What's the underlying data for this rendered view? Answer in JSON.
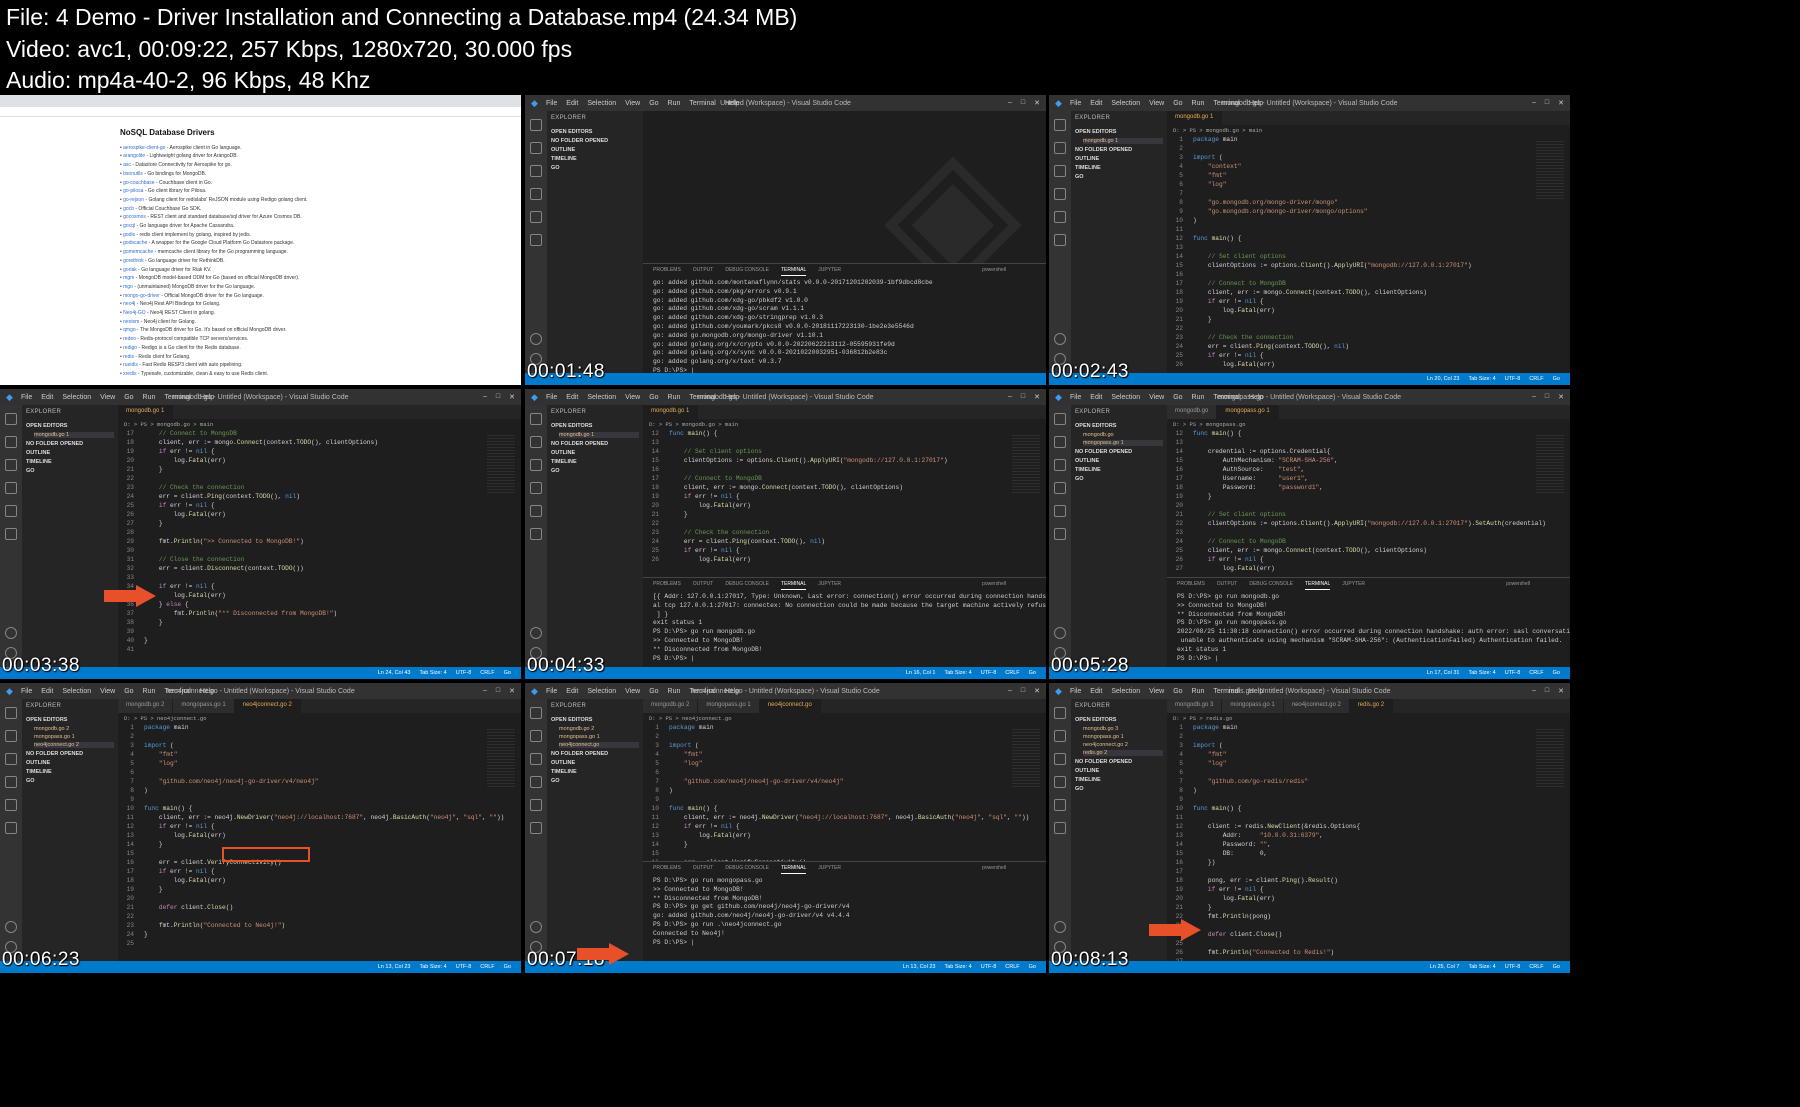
{
  "header": {
    "file_line": "File: 4  Demo - Driver Installation and Connecting a Database.mp4 (24.34 MB)",
    "video_line": "Video: avc1, 00:09:22, 257 Kbps, 1280x720, 30.000 fps",
    "audio_line": "Audio: mp4a-40-2, 96 Kbps, 48 Khz"
  },
  "vscode": {
    "menu": [
      "File",
      "Edit",
      "Selection",
      "View",
      "Go",
      "Run",
      "Terminal",
      "Help"
    ],
    "explorer": "EXPLORER",
    "open_editors": "OPEN EDITORS",
    "no_folder": "NO FOLDER OPENED",
    "outline": "OUTLINE",
    "timeline": "TIMELINE",
    "go": "GO",
    "panel_tabs": [
      "PROBLEMS",
      "OUTPUT",
      "DEBUG CONSOLE",
      "TERMINAL",
      "JUPYTER"
    ],
    "terminal_label": "powershell"
  },
  "thumbs": [
    {
      "timestamp": "",
      "browser": {
        "heading": "NoSQL Database Drivers",
        "items": [
          "aerospike-client-go - Aerospike client in Go language.",
          "arangolite - Lightweight golang driver for ArangoDB.",
          "asc - Datastore Connectivity for Aerospike for go.",
          "bsonutils - Go bindings for MongoDB.",
          "go-couchbase - Couchbase client in Go.",
          "go-pilosa - Go client library for Pilosa.",
          "go-rejson - Golang client for redislabs' ReJSON module using Redigo golang client.",
          "gocb - Official Couchbase Go SDK.",
          "gocosmos - REST client and standard database/sql driver for Azure Cosmos DB.",
          "gocql - Go language driver for Apache Cassandra.",
          "godis - redis client implement by golang, inspired by jedis.",
          "godscache - A wrapper for the Google Cloud Platform Go Datastore package.",
          "gomemcache - memcache client library for the Go programming language.",
          "gorethink - Go language driver for RethinkDB.",
          "goriak - Go language driver for Riak KV.",
          "mgm - MongoDB model-based ODM for Go (based on official MongoDB driver).",
          "mgo - (unmaintained) MongoDB driver for the Go language.",
          "mongo-go-driver - Official MongoDB driver for the Go language.",
          "neo4j - Neo4j Rest API Bindings for Golang.",
          "Neo4j-GO - Neo4j REST Client in golang.",
          "neoism - Neo4j client for Golang.",
          "qmgo - The MongoDB driver for Go. It's based on official MongoDB driver.",
          "redeo - Redis-protocol compatible TCP servers/services.",
          "redigo - Redigo is a Go client for the Redis database.",
          "redis - Redis client for Golang.",
          "rueidis - Fast Redis RESP3 client with auto pipelining.",
          "xredis - Typesafe, customizable, clean & easy to use Redis client."
        ],
        "heading2": "Search and Analytic Databases"
      }
    },
    {
      "timestamp": "00:01:48",
      "title": "Untitled (Workspace) - Visual Studio Code",
      "terminal": [
        "go: added github.com/montanaflynn/stats v0.0.0-20171201202039-1bf9dbcd8cbe",
        "go: added github.com/pkg/errors v0.9.1",
        "go: added github.com/xdg-go/pbkdf2 v1.0.0",
        "go: added github.com/xdg-go/scram v1.1.1",
        "go: added github.com/xdg-go/stringprep v1.0.3",
        "go: added github.com/youmark/pkcs8 v0.0.0-20181117223130-1be2e3e5546d",
        "go: added go.mongodb.org/mongo-driver v1.10.1",
        "go: added golang.org/x/crypto v0.0.0-20220622213112-05595931fe9d",
        "go: added golang.org/x/sync v0.0.0-20210220032951-036812b2e83c",
        "go: added golang.org/x/text v0.3.7",
        "PS D:\\PS> |"
      ]
    },
    {
      "timestamp": "00:02:43",
      "title": "mongodb.go - Untitled (Workspace) - Visual Studio Code",
      "tabs": [
        "mongodb.go 1"
      ],
      "crumb": "D: > PS > mongodb.go > main",
      "code_start": 1,
      "code": [
        "package main",
        "",
        "import (",
        "    \"context\"",
        "    \"fmt\"",
        "    \"log\"",
        "",
        "    \"go.mongodb.org/mongo-driver/mongo\"",
        "    \"go.mongodb.org/mongo-driver/mongo/options\"",
        ")",
        "",
        "func main() {",
        "",
        "    // Set client options",
        "    clientOptions := options.Client().ApplyURI(\"mongodb://127.0.0.1:27017\")",
        "",
        "    // Connect to MongoDB",
        "    client, err := mongo.Connect(context.TODO(), clientOptions)",
        "    if err != nil {",
        "        log.Fatal(err)",
        "    }",
        "",
        "    // Check the connection",
        "    err = client.Ping(context.TODO(), nil)",
        "    if err != nil {",
        "        log.Fatal(err)"
      ],
      "status": [
        "Ln 20, Col 23",
        "Tab Size: 4",
        "UTF-8",
        "CRLF",
        "Go"
      ]
    },
    {
      "timestamp": "00:03:38",
      "title": "mongodb.go - Untitled (Workspace) - Visual Studio Code",
      "tabs": [
        "mongodb.go 1"
      ],
      "crumb": "D: > PS > mongodb.go > main",
      "code_start": 17,
      "code": [
        "    // Connect to MongoDB",
        "    client, err := mongo.Connect(context.TODO(), clientOptions)",
        "    if err != nil {",
        "        log.Fatal(err)",
        "    }",
        "",
        "    // Check the connection",
        "    err = client.Ping(context.TODO(), nil)",
        "    if err != nil {",
        "        log.Fatal(err)",
        "    }",
        "",
        "    fmt.Println(\">> Connected to MongoDB!\")",
        "",
        "    // Close the connection",
        "    err = client.Disconnect(context.TODO())",
        "",
        "    if err != nil {",
        "        log.Fatal(err)",
        "    } else {",
        "        fmt.Println(\"** Disconnected from MongoDB!\")",
        "    }",
        "",
        "}",
        ""
      ],
      "status": [
        "Ln 24, Col 43",
        "Tab Size: 4",
        "UTF-8",
        "CRLF",
        "Go"
      ]
    },
    {
      "timestamp": "00:04:33",
      "title": "mongodb.go - Untitled (Workspace) - Visual Studio Code",
      "tabs": [
        "mongodb.go 1"
      ],
      "crumb": "D: > PS > mongodb.go > main",
      "code_start": 12,
      "code": [
        "func main() {",
        "",
        "    // Set client options",
        "    clientOptions := options.Client().ApplyURI(\"mongodb://127.0.0.1:27017\")",
        "",
        "    // Connect to MongoDB",
        "    client, err := mongo.Connect(context.TODO(), clientOptions)",
        "    if err != nil {",
        "        log.Fatal(err)",
        "    }",
        "",
        "    // Check the connection",
        "    err = client.Ping(context.TODO(), nil)",
        "    if err != nil {",
        "        log.Fatal(err)"
      ],
      "terminal": [
        "[{ Addr: 127.0.0.1:27017, Type: Unknown, Last error: connection() error occurred during connection handshake: di",
        "al tcp 127.0.0.1:27017: connectex: No connection could be made because the target machine actively refused it. },",
        " ] }",
        "exit status 1",
        "PS D:\\PS> go run mongodb.go",
        ">> Connected to MongoDB!",
        "** Disconnected from MongoDB!",
        "PS D:\\PS> |"
      ],
      "status": [
        "Ln 16, Col 1",
        "Tab Size: 4",
        "UTF-8",
        "CRLF",
        "Go"
      ]
    },
    {
      "timestamp": "00:05:28",
      "title": "mongopass.go - Untitled (Workspace) - Visual Studio Code",
      "tabs": [
        "mongodb.go",
        "mongopass.go 1"
      ],
      "crumb": "D: > PS > mongopass.go",
      "code_start": 12,
      "code": [
        "func main() {",
        "",
        "    credential := options.Credential{",
        "        AuthMechanism: \"SCRAM-SHA-256\",",
        "        AuthSource:    \"test\",",
        "        Username:      \"user1\",",
        "        Password:      \"password1\",",
        "    }",
        "",
        "    // Set client options",
        "    clientOptions := options.Client().ApplyURI(\"mongodb://127.0.0.1:27017\").SetAuth(credential)",
        "",
        "    // Connect to MongoDB",
        "    client, err := mongo.Connect(context.TODO(), clientOptions)",
        "    if err != nil {",
        "        log.Fatal(err)"
      ],
      "terminal": [
        "PS D:\\PS> go run mongodb.go",
        ">> Connected to MongoDB!",
        "** Disconnected from MongoDB!",
        "PS D:\\PS> go run mongopass.go",
        "2022/08/25 11:30:18 connection() error occurred during connection handshake: auth error: sasl conversation error:",
        " unable to authenticate using mechanism \"SCRAM-SHA-256\": (AuthenticationFailed) Authentication failed.",
        "exit status 1",
        "PS D:\\PS> |"
      ],
      "status": [
        "Ln 17, Col 31",
        "Tab Size: 4",
        "UTF-8",
        "CRLF",
        "Go"
      ]
    },
    {
      "timestamp": "00:06:23",
      "title": "neo4jconnect.go - Untitled (Workspace) - Visual Studio Code",
      "tabs": [
        "mongodb.go 2",
        "mongopass.go 1",
        "neo4jconnect.go 2"
      ],
      "crumb": "D: > PS > neo4jconnect.go",
      "code_start": 1,
      "code": [
        "package main",
        "",
        "import (",
        "    \"fmt\"",
        "    \"log\"",
        "",
        "    \"github.com/neo4j/neo4j-go-driver/v4/neo4j\"",
        ")",
        "",
        "func main() {",
        "    client, err := neo4j.NewDriver(\"neo4j://localhost:7687\", neo4j.BasicAuth(\"neo4j\", \"sql\", \"\"))",
        "    if err != nil {",
        "        log.Fatal(err)",
        "    }",
        "",
        "    err = client.VerifyConnectivity()",
        "    if err != nil {",
        "        log.Fatal(err)",
        "    }",
        "",
        "    defer client.Close()",
        "",
        "    fmt.Println(\"Connected to Neo4j!\")",
        "}",
        ""
      ],
      "status": [
        "Ln 13, Col 23",
        "Tab Size: 4",
        "UTF-8",
        "CRLF",
        "Go"
      ]
    },
    {
      "timestamp": "00:07:18",
      "title": "neo4jconnect.go - Untitled (Workspace) - Visual Studio Code",
      "tabs": [
        "mongodb.go 2",
        "mongopass.go 1",
        "neo4jconnect.go"
      ],
      "crumb": "D: > PS > neo4jconnect.go",
      "code_start": 1,
      "code": [
        "package main",
        "",
        "import (",
        "    \"fmt\"",
        "    \"log\"",
        "",
        "    \"github.com/neo4j/neo4j-go-driver/v4/neo4j\"",
        ")",
        "",
        "func main() {",
        "    client, err := neo4j.NewDriver(\"neo4j://localhost:7687\", neo4j.BasicAuth(\"neo4j\", \"sql\", \"\"))",
        "    if err != nil {",
        "        log.Fatal(err)",
        "    }",
        "",
        "    err = client.VerifyConnectivity()",
        "    if err != nil {"
      ],
      "terminal": [
        "PS D:\\PS> go run mongopass.go",
        ">> Connected to MongoDB!",
        "** Disconnected from MongoDB!",
        "PS D:\\PS> go get github.com/neo4j/neo4j-go-driver/v4",
        "go: added github.com/neo4j/neo4j-go-driver/v4 v4.4.4",
        "PS D:\\PS> go run .\\neo4jconnect.go",
        "Connected to Neo4j!",
        "PS D:\\PS> |"
      ],
      "status": [
        "Ln 13, Col 23",
        "Tab Size: 4",
        "UTF-8",
        "CRLF",
        "Go"
      ]
    },
    {
      "timestamp": "00:08:13",
      "title": "redis.go - Untitled (Workspace) - Visual Studio Code",
      "tabs": [
        "mongodb.go 3",
        "mongopass.go 1",
        "neo4jconnect.go 2",
        "redis.go 2"
      ],
      "crumb": "D: > PS > redis.go",
      "code_start": 1,
      "code": [
        "package main",
        "",
        "import (",
        "    \"fmt\"",
        "    \"log\"",
        "",
        "    \"github.com/go-redis/redis\"",
        ")",
        "",
        "func main() {",
        "",
        "    client := redis.NewClient(&redis.Options{",
        "        Addr:     \"10.0.0.31:6379\",",
        "        Password: \"\",",
        "        DB:       0,",
        "    })",
        "",
        "    pong, err := client.Ping().Result()",
        "    if err != nil {",
        "        log.Fatal(err)",
        "    }",
        "    fmt.Println(pong)",
        "",
        "    defer client.Close()",
        "",
        "    fmt.Println(\"Connected to Redis!\")",
        ""
      ],
      "status": [
        "Ln 25, Col 7",
        "Tab Size: 4",
        "UTF-8",
        "CRLF",
        "Go"
      ]
    }
  ],
  "colors": {
    "statusbar": "#007acc",
    "arrow": "#e8502a",
    "editor_bg": "#1e1e1e"
  }
}
